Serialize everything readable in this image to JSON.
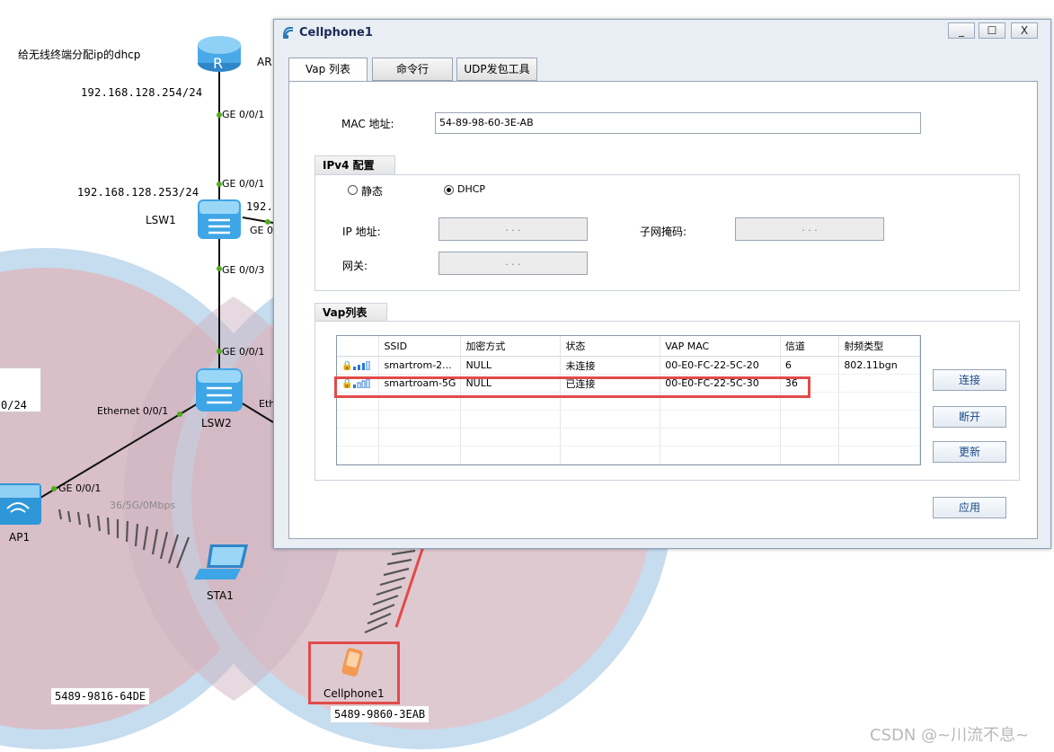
{
  "topology": {
    "router_note": "给无线终端分配ip的dhcp",
    "router_name": "AR",
    "router_ip": "192.168.128.254/24",
    "router_port": "GE 0/0/1",
    "lsw1_port_up": "GE 0/0/1",
    "lsw1_ip": "192.168.128.253/24",
    "lsw1_name": "LSW1",
    "lsw1_side_ip": "192.",
    "lsw1_side_port": "GE 0",
    "lsw1_port_down": "GE 0/0/3",
    "lsw2_port_up": "GE 0/0/1",
    "lsw2_name": "LSW2",
    "lsw2_port_left": "Ethernet 0/0/1",
    "lsw2_port_right": "Eth",
    "ap1_port": "GE 0/0/1",
    "ap1_name": "AP1",
    "ap1_ip_frag": "0/24",
    "ap1_radio": "36/5G/0Mbps",
    "sta1_name": "STA1",
    "sta1_mac": "5489-9816-64DE",
    "cellphone_name": "Cellphone1",
    "cellphone_mac": "5489-9860-3EAB"
  },
  "dialog": {
    "title": "Cellphone1",
    "controls": {
      "minimize": "_",
      "maximize": "☐",
      "close": "X"
    },
    "tabs": [
      {
        "label": "Vap 列表",
        "active": true
      },
      {
        "label": "命令行",
        "active": false
      },
      {
        "label": "UDP发包工具",
        "active": false
      }
    ],
    "mac_label": "MAC 地址:",
    "mac_value": "54-89-98-60-3E-AB",
    "ipv4": {
      "group_title": "IPv4 配置",
      "static_label": "静态",
      "dhcp_label": "DHCP",
      "selected": "DHCP",
      "ip_label": "IP 地址:",
      "ip_value": ".     .     .",
      "mask_label": "子网掩码:",
      "mask_value": ".     .     .",
      "gateway_label": "网关:",
      "gateway_value": ".     .     ."
    },
    "vap": {
      "group_title": "Vap列表",
      "columns": [
        "",
        "SSID",
        "加密方式",
        "状态",
        "VAP MAC",
        "信道",
        "射频类型"
      ],
      "rows": [
        {
          "ssid": "smartrom-2...",
          "encryption": "NULL",
          "status": "未连接",
          "vap_mac": "00-E0-FC-22-5C-20",
          "channel": "6",
          "radio": "802.11bgn"
        },
        {
          "ssid": "smartroam-5G",
          "encryption": "NULL",
          "status": "已连接",
          "vap_mac": "00-E0-FC-22-5C-30",
          "channel": "36",
          "radio": ""
        }
      ],
      "connect_label": "连接",
      "disconnect_label": "断开",
      "refresh_label": "更新"
    },
    "apply_label": "应用"
  },
  "colors": {
    "annotation_red": "#e14b4b",
    "coverage_fill": "#d9bfc8",
    "coverage_ring": "#c8dff0",
    "link_dot": "#4caf1a",
    "device_blue": "#3aa3e0"
  },
  "watermark": "CSDN @~川流不息~"
}
